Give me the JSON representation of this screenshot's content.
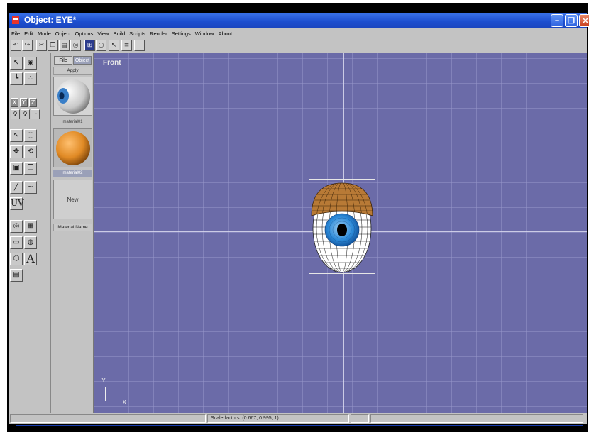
{
  "window": {
    "title": "Object: EYE*",
    "minimize_glyph": "–",
    "maximize_glyph": "❐",
    "close_glyph": "✕"
  },
  "menu": [
    "File",
    "Edit",
    "Mode",
    "Object",
    "Options",
    "View",
    "Build",
    "Scripts",
    "Render",
    "Settings",
    "Window",
    "About"
  ],
  "toolbar": {
    "icons": [
      "undo-icon",
      "redo-icon",
      "cut-icon",
      "copy-icon",
      "paste-icon",
      "paste-special-icon",
      "grid-icon",
      "wireframe-icon",
      "snap-icon",
      "list-icon",
      "blank-icon"
    ]
  },
  "tools": {
    "axis_labels": [
      "X",
      "Y",
      "Z"
    ],
    "uv_label": "UV",
    "text_tool_label": "A"
  },
  "materials": {
    "tabs": [
      "File",
      "Object"
    ],
    "apply_label": "Apply",
    "items": [
      {
        "name": "material01",
        "color": "#e6e6e6"
      },
      {
        "name": "material02",
        "color": "#e08a25"
      }
    ],
    "new_label": "New",
    "name_label": "Material Name"
  },
  "viewport": {
    "label": "Front",
    "axis_y": "Y",
    "axis_x": "x",
    "background_color": "#6b6ba8",
    "selected_object": "EYE"
  },
  "status": {
    "scale_factors": "Scale factors: (0.667, 0.995, 1)"
  }
}
